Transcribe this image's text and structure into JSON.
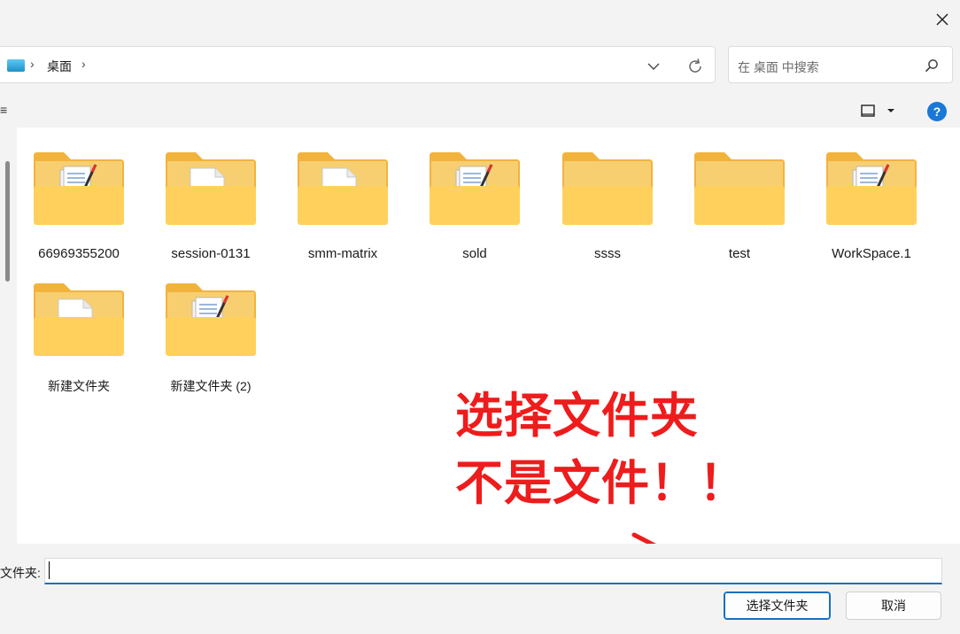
{
  "window": {
    "close_icon": "close-icon"
  },
  "address_bar": {
    "location_icon": "desktop-icon",
    "breadcrumb": [
      "桌面"
    ],
    "dropdown_icon": "chevron-down-icon",
    "refresh_icon": "refresh-icon"
  },
  "search": {
    "placeholder": "在 桌面 中搜索",
    "icon": "search-icon"
  },
  "toolbar": {
    "left_edge_text": "≡",
    "view_icon": "view-layout-icon",
    "view_menu_icon": "chevron-down-icon",
    "help_label": "?"
  },
  "folders": [
    {
      "name": "66969355200",
      "variant": "docs"
    },
    {
      "name": "session-0131",
      "variant": "page"
    },
    {
      "name": "smm-matrix",
      "variant": "page"
    },
    {
      "name": "sold",
      "variant": "docs"
    },
    {
      "name": "ssss",
      "variant": "empty"
    },
    {
      "name": "test",
      "variant": "empty"
    },
    {
      "name": "WorkSpace.1",
      "variant": "docs"
    },
    {
      "name": "新建文件夹",
      "variant": "page"
    },
    {
      "name": "新建文件夹 (2)",
      "variant": "docs"
    }
  ],
  "annotation": {
    "line1": "选择文件夹",
    "line2": "不是文件！！",
    "color": "#ee1c1c"
  },
  "footer": {
    "field_label": "文件夹:",
    "field_value": "",
    "select_button": "选择文件夹",
    "cancel_button": "取消"
  },
  "colors": {
    "accent": "#1a6fc0",
    "folder_back": "#f2b33d",
    "folder_front": "#ffd15c"
  }
}
